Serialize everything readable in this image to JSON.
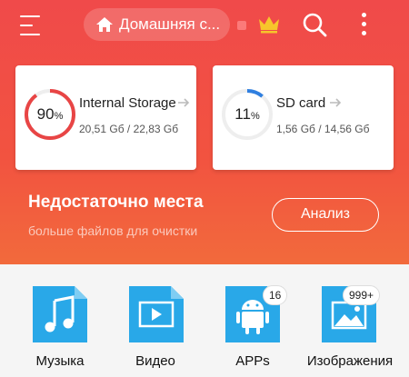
{
  "header": {
    "location": "Домашняя с...",
    "icons": [
      "menu-icon",
      "home-icon",
      "crown-icon",
      "search-icon",
      "more-icon"
    ]
  },
  "storage": [
    {
      "name": "Internal Storage",
      "percent": "90",
      "percent_sign": "%",
      "percent_value": 0.9,
      "size": "20,51 Gб / 22,83 Gб",
      "ring_color": "#e84545"
    },
    {
      "name": "SD card",
      "percent": "11",
      "percent_sign": "%",
      "percent_value": 0.11,
      "size": "1,56 Gб / 14,56 Gб",
      "ring_color": "#2f7fe0"
    }
  ],
  "warning": {
    "title": "Недостаточно места",
    "subtitle": "больше файлов для очистки",
    "button": "Анализ"
  },
  "categories": [
    {
      "label": "Музыка",
      "icon": "music-icon"
    },
    {
      "label": "Видео",
      "icon": "video-icon"
    },
    {
      "label": "APPs",
      "icon": "android-icon",
      "badge": "16"
    },
    {
      "label": "Изображения",
      "icon": "image-icon",
      "badge": "999+"
    }
  ],
  "colors": {
    "accent": "#f04a4a",
    "category_icon": "#29a8e8"
  }
}
